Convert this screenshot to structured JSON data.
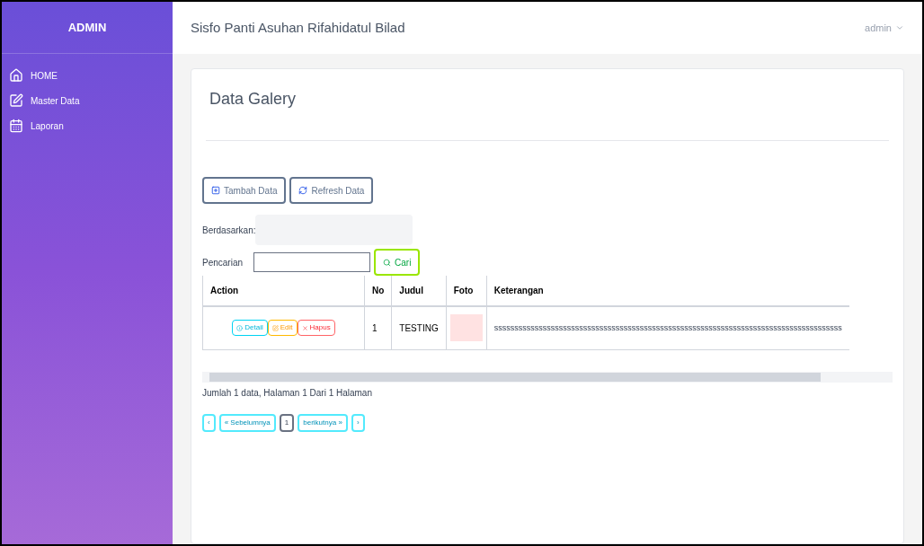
{
  "sidebar": {
    "brand": "ADMIN",
    "items": [
      {
        "label": "HOME"
      },
      {
        "label": "Master Data"
      },
      {
        "label": "Laporan"
      }
    ]
  },
  "header": {
    "title": "Sisfo Panti Asuhan Rifahidatul Bilad",
    "user": "admin"
  },
  "panel": {
    "title": "Data Galery",
    "buttons": [
      {
        "label": "Tambah Data"
      },
      {
        "label": "Refresh Data"
      }
    ],
    "filter": {
      "label": "Berdasarkan:"
    },
    "search": {
      "label": "Pencarian",
      "button": "Cari"
    },
    "table": {
      "columns": [
        "Action",
        "No",
        "Judul",
        "Foto",
        "Keterangan"
      ],
      "rows": [
        {
          "actions": [
            {
              "label": "Detail",
              "kind": "detail"
            },
            {
              "label": "Edit",
              "kind": "edit"
            },
            {
              "label": "Hapus",
              "kind": "delete"
            }
          ],
          "no": "1",
          "judul": "TESTING",
          "keterangan": "ssssssssssssssssssssssssssssssssssssssssssssssssssssssssssssssssssssssssssssssssssssss"
        }
      ]
    },
    "summary": "Jumlah 1 data, Halaman 1 Dari 1 Halaman",
    "pagination": [
      {
        "label": "‹",
        "selected": false
      },
      {
        "label": "« Sebelumnya",
        "selected": false
      },
      {
        "label": "1",
        "selected": true
      },
      {
        "label": "berikutnya »",
        "selected": false
      },
      {
        "label": "›",
        "selected": false
      }
    ]
  }
}
